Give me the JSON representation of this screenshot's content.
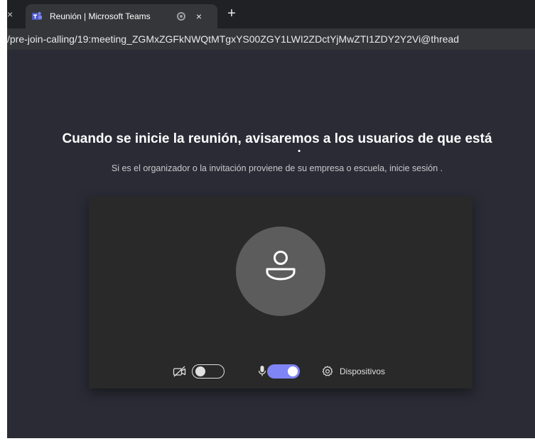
{
  "browser": {
    "prev_tab_close": "×",
    "tab": {
      "title": "Reunión | Microsoft Teams",
      "close": "×"
    },
    "new_tab": "+",
    "url": "/pre-join-calling/19:meeting_ZGMxZGFkNWQtMTgxYS00ZGY1LWI2ZDctYjMwZTI1ZDY2Y2Vi@thread"
  },
  "prejoin": {
    "heading": "Cuando se inicie la reunión, avisaremos a los usuarios de que está esperando.",
    "subtext": "Si es el organizador o la invitación proviene de su empresa o escuela, inicie sesión .",
    "controls": {
      "camera_on": false,
      "mic_on": true,
      "devices_label": "Dispositivos"
    }
  },
  "colors": {
    "page_bg": "#2b2b36",
    "preview_bg": "#292929",
    "accent": "#7f85f5"
  }
}
